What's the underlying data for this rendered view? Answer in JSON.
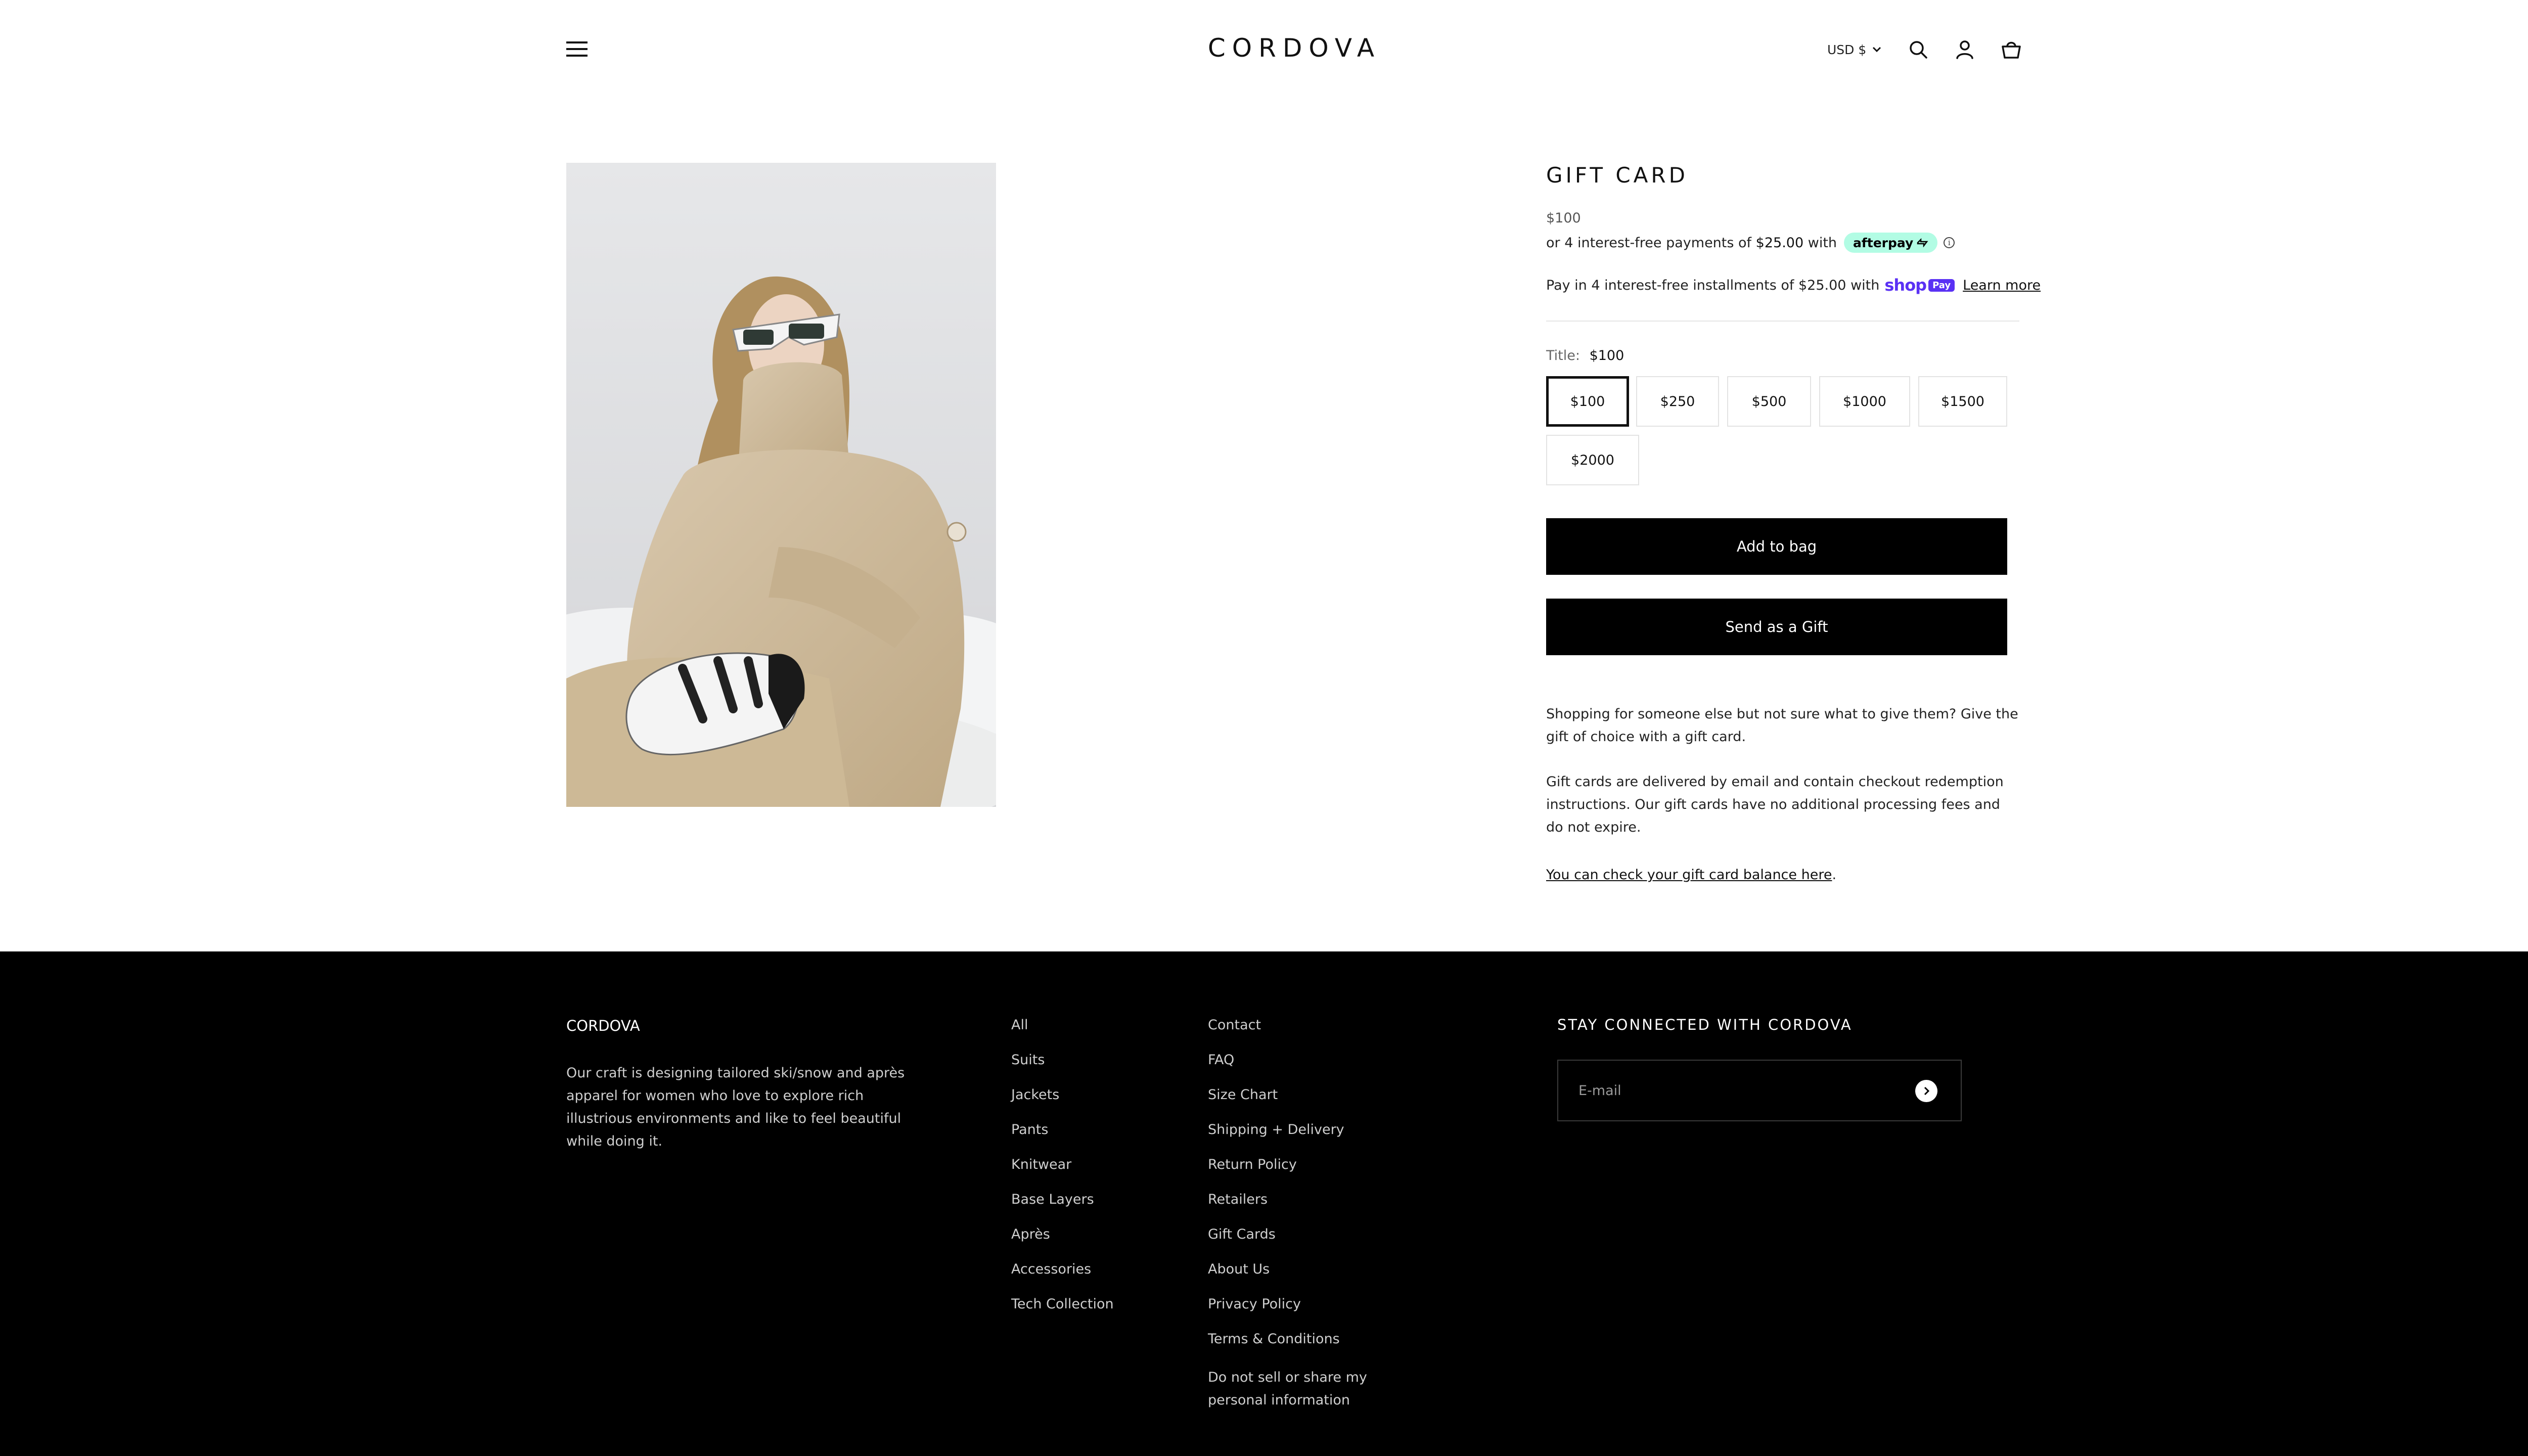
{
  "header": {
    "logo": "CORDOVA",
    "currency": "USD $"
  },
  "product": {
    "image_alt": "Model in beige ski suit with white sunglasses and black-and-white gloves",
    "title": "GIFT CARD",
    "price": "$100",
    "afterpay": {
      "prefix": "or 4 interest-free payments of",
      "amount": "$25.00",
      "suffix": "with",
      "badge": "afterpay"
    },
    "shoppay": {
      "text_before": "Pay in 4 interest-free installments of",
      "amount": "$25.00",
      "text_after": "with",
      "shop": "shop",
      "pay": "Pay",
      "learn_more": "Learn more"
    },
    "variant": {
      "label": "Title:",
      "selected": "$100",
      "options": [
        "$100",
        "$250",
        "$500",
        "$1000",
        "$1500",
        "$2000"
      ]
    },
    "add_to_bag": "Add to bag",
    "send_gift": "Send as a Gift",
    "description": {
      "p1": "Shopping for someone else but not sure what to give them? Give the gift of choice with a gift card.",
      "p2": "Gift cards are delivered by email and contain checkout redemption instructions. Our gift cards have no additional processing fees and do not expire.",
      "balance_link": "You can check your gift card balance here",
      "balance_suffix": "."
    }
  },
  "footer": {
    "brand": "CORDOVA",
    "about": "Our craft is designing tailored ski/snow and après apparel for women who love to explore rich illustrious environments and like to feel beautiful while doing it.",
    "shop_links": [
      "All",
      "Suits",
      "Jackets",
      "Pants",
      "Knitwear",
      "Base Layers",
      "Après",
      "Accessories",
      "Tech Collection"
    ],
    "info_links": [
      "Contact",
      "FAQ",
      "Size Chart",
      "Shipping + Delivery",
      "Return Policy",
      "Retailers",
      "Gift Cards",
      "About Us",
      "Privacy Policy",
      "Terms & Conditions",
      "Do not sell or share my personal information"
    ],
    "newsletter": {
      "heading": "STAY CONNECTED WITH CORDOVA",
      "placeholder": "E-mail"
    }
  },
  "colors": {
    "footer_bg": "#000000",
    "button_bg": "#000000",
    "afterpay_mint": "#b2fce4",
    "shoppay_purple": "#5a31f4"
  },
  "icons": [
    "menu-icon",
    "search-icon",
    "account-icon",
    "bag-icon",
    "chevron-down-icon",
    "info-icon",
    "arrow-right-icon"
  ]
}
